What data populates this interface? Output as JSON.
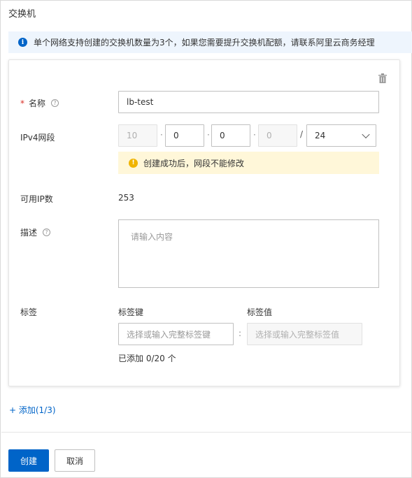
{
  "page": {
    "title": "交换机"
  },
  "notice": {
    "text": "单个网络支持创建的交换机数量为3个，如果您需要提升交换机配额，请联系阿里云商务经理"
  },
  "form": {
    "name": {
      "label": "名称",
      "required_mark": "*",
      "value": "lb-test"
    },
    "ipv4": {
      "label": "IPv4网段",
      "octets": [
        "10",
        "0",
        "0",
        "0"
      ],
      "separator": "·",
      "slash": "/",
      "prefix": "24",
      "warning": "创建成功后，网段不能修改"
    },
    "available_ip": {
      "label": "可用IP数",
      "value": "253"
    },
    "description": {
      "label": "描述",
      "placeholder": "请输入内容"
    },
    "tags": {
      "label": "标签",
      "key_header": "标签键",
      "value_header": "标签值",
      "key_placeholder": "选择或输入完整标签键",
      "value_placeholder": "选择或输入完整标签值",
      "colon": ":",
      "count_text": "已添加 0/20 个"
    }
  },
  "add_link": "+ 添加(1/3)",
  "buttons": {
    "create": "创建",
    "cancel": "取消"
  },
  "colors": {
    "primary": "#0064c8",
    "required": "#d93026",
    "warning_bg": "#fff7d9",
    "notice_bg": "#eef5fd"
  }
}
